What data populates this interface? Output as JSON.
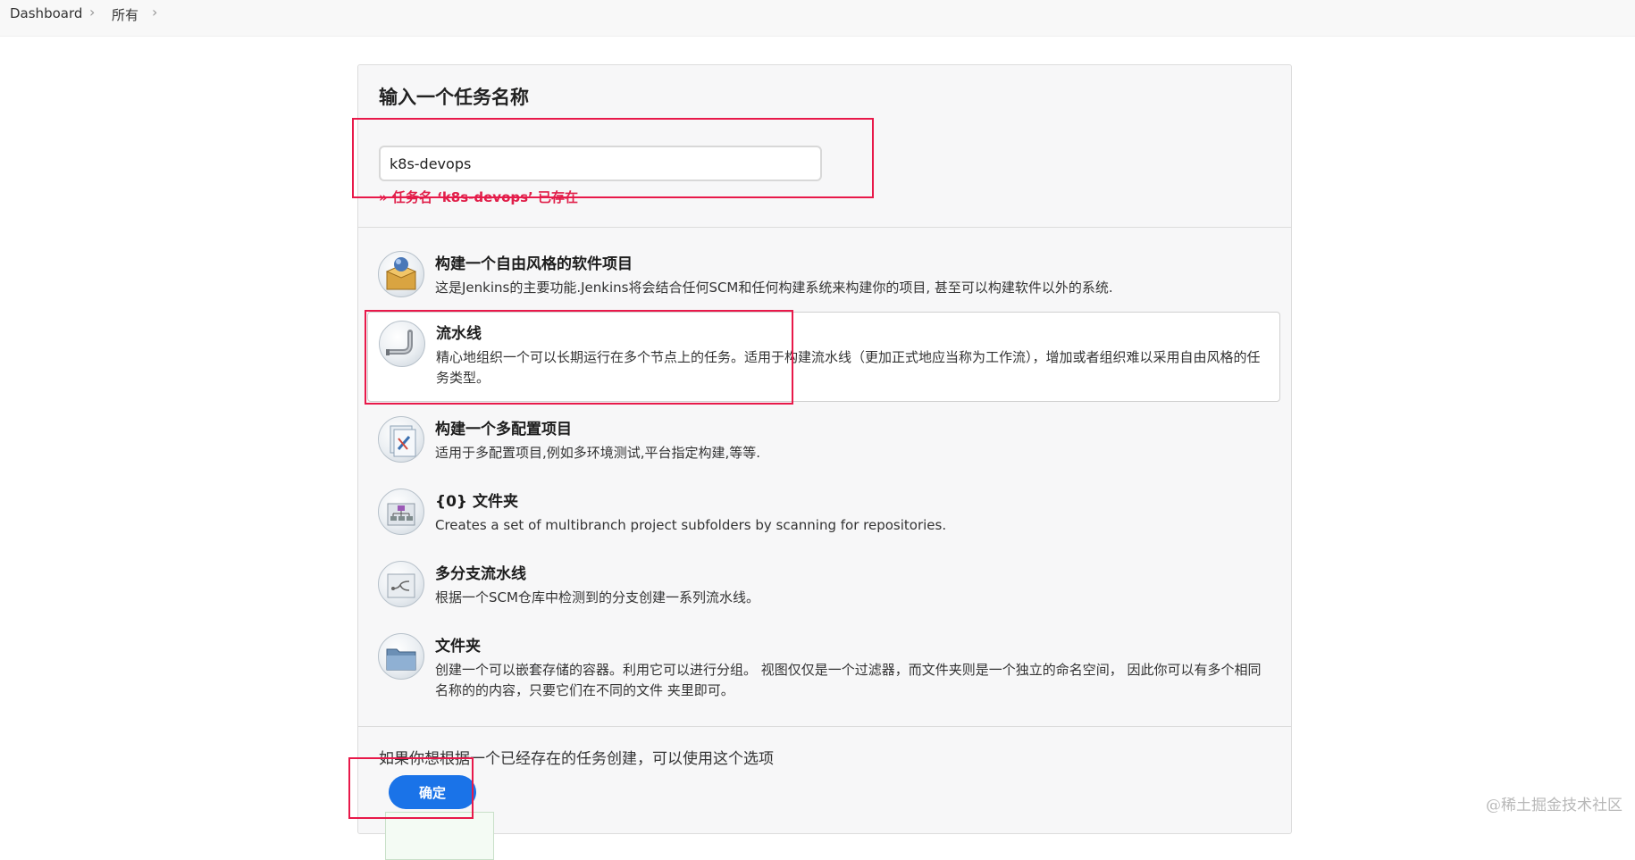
{
  "breadcrumb": {
    "items": [
      "Dashboard",
      "所有"
    ]
  },
  "form": {
    "title": "输入一个任务名称",
    "name_value": "k8s-devops",
    "error": "» 任务名 ‘k8s-devops’ 已存在"
  },
  "items": [
    {
      "title": "构建一个自由风格的软件项目",
      "description": "这是Jenkins的主要功能.Jenkins将会结合任何SCM和任何构建系统来构建你的项目, 甚至可以构建软件以外的系统.",
      "icon": "freestyle-box-icon"
    },
    {
      "title": "流水线",
      "description": "精心地组织一个可以长期运行在多个节点上的任务。适用于构建流水线（更加正式地应当称为工作流），增加或者组织难以采用自由风格的任务类型。",
      "icon": "pipeline-icon"
    },
    {
      "title": "构建一个多配置项目",
      "description": "适用于多配置项目,例如多环境测试,平台指定构建,等等.",
      "icon": "multi-config-icon"
    },
    {
      "title": "{0} 文件夹",
      "description": "Creates a set of multibranch project subfolders by scanning for repositories.",
      "icon": "org-folder-icon"
    },
    {
      "title": "多分支流水线",
      "description": "根据一个SCM仓库中检测到的分支创建一系列流水线。",
      "icon": "multibranch-icon"
    },
    {
      "title": "文件夹",
      "description": "创建一个可以嵌套存储的容器。利用它可以进行分组。 视图仅仅是一个过滤器，而文件夹则是一个独立的命名空间， 因此你可以有多个相同名称的的内容，只要它们在不同的文件 夹里即可。",
      "icon": "folder-icon"
    }
  ],
  "copy": {
    "label": "如果你想根据一个已经存在的任务创建，可以使用这个选项"
  },
  "ok_button": "确定",
  "watermark": "@稀土掘金技术社区",
  "colors": {
    "accent": "#1a73e8",
    "error": "#e0204a",
    "highlight": "#e8194a"
  }
}
